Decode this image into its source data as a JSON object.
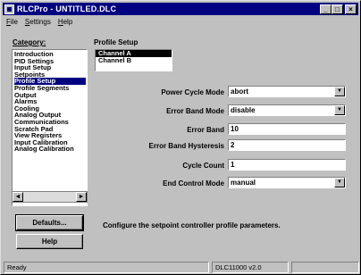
{
  "window": {
    "title": "RLCPro - UNTITLED.DLC",
    "controls": {
      "minimize": "_",
      "maximize": "□",
      "close": "×"
    }
  },
  "menu": [
    "File",
    "Settings",
    "Help"
  ],
  "category": {
    "label": "Category:",
    "items": [
      "Introduction",
      "PID Settings",
      "Input Setup",
      "Setpoints",
      "Profile Setup",
      "Profile Segments",
      "Output",
      "Alarms",
      "Cooling",
      "Analog Output",
      "Communications",
      "Scratch Pad",
      "View Registers",
      "Input Calibration",
      "Analog Calibration"
    ],
    "selected": "Profile Setup",
    "scroll_left": "◄",
    "scroll_right": "►"
  },
  "buttons": {
    "defaults": "Defaults...",
    "help": "Help"
  },
  "profile": {
    "heading": "Profile Setup",
    "channels": [
      "Channel A",
      "Channel B"
    ],
    "selected_channel": "Channel A",
    "fields": {
      "power_cycle_mode": {
        "label": "Power Cycle Mode",
        "value": "abort"
      },
      "error_band_mode": {
        "label": "Error Band Mode",
        "value": "disable"
      },
      "error_band": {
        "label": "Error Band",
        "value": "10"
      },
      "error_band_hysteresis": {
        "label": "Error Band Hysteresis",
        "value": "2"
      },
      "cycle_count": {
        "label": "Cycle Count",
        "value": "1"
      },
      "end_control_mode": {
        "label": "End Control Mode",
        "value": "manual"
      }
    },
    "combo_arrow": "▼",
    "description": "Configure the setpoint controller profile parameters."
  },
  "status": {
    "left": "Ready",
    "version": "DLC11000 v2.0",
    "right": ""
  }
}
